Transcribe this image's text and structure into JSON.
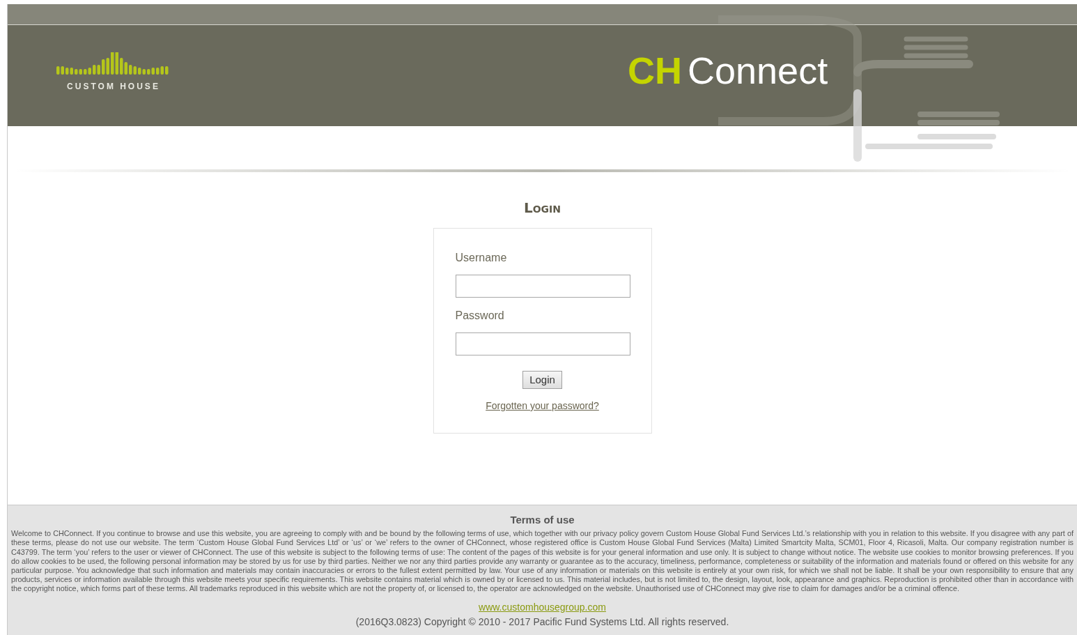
{
  "header": {
    "company_logo": {
      "text": "CUSTOM HOUSE"
    },
    "product_logo": {
      "accent": "CH",
      "name": "Connect"
    }
  },
  "login": {
    "title": "Login",
    "fields": [
      {
        "label": "Username"
      },
      {
        "label": "Password"
      }
    ],
    "submit": "Login",
    "forgot_link": "Forgotten your password?"
  },
  "footer": {
    "terms_title": "Terms of use",
    "terms_text": "Welcome to CHConnect. If you continue to browse and use this website, you are agreeing to comply with and be bound by the following terms of use, which together with our privacy policy govern Custom House Global Fund Services Ltd.’s relationship with you in relation to this website. If you disagree with any part of these terms, please do not use our website. The term ‘Custom House Global Fund Services Ltd’ or ‘us’ or ‘we’ refers to the owner of CHConnect, whose registered office is Custom House Global Fund Services (Malta) Limited Smartcity Malta, SCM01, Floor 4, Ricasoli, Malta. Our company registration number is C43799. The term ‘you’ refers to the user or viewer of CHConnect. The use of this website is subject to the following terms of use: The content of the pages of this website is for your general information and use only. It is subject to change without notice. The website use cookies to monitor browsing preferences. If you do allow cookies to be used, the following personal information may be stored by us for use by third parties. Neither we nor any third parties provide any warranty or guarantee as to the accuracy, timeliness, performance, completeness or suitability of the information and materials found or offered on this website for any particular purpose. You acknowledge that such information and materials may contain inaccuracies or errors to the fullest extent permitted by law. Your use of any information or materials on this website is entirely at your own risk, for which we shall not be liable. It shall be your own responsibility to ensure that any products, services or information available through this website meets your specific requirements. This website contains material which is owned by or licensed to us. This material includes, but is not limited to, the design, layout, look, appearance and graphics. Reproduction is prohibited other than in accordance with the copyright notice, which forms part of these terms. All trademarks reproduced in this website which are not the property of, or licensed to, the operator are acknowledged on the website. Unauthorised use of CHConnect may give rise to claim for damages and/or be a criminal offence.",
    "website_link": "www.customhousegroup.com",
    "copyright": "(2016Q3.0823) Copyright © 2010 - 2017 Pacific Fund Systems Ltd. All rights reserved."
  }
}
